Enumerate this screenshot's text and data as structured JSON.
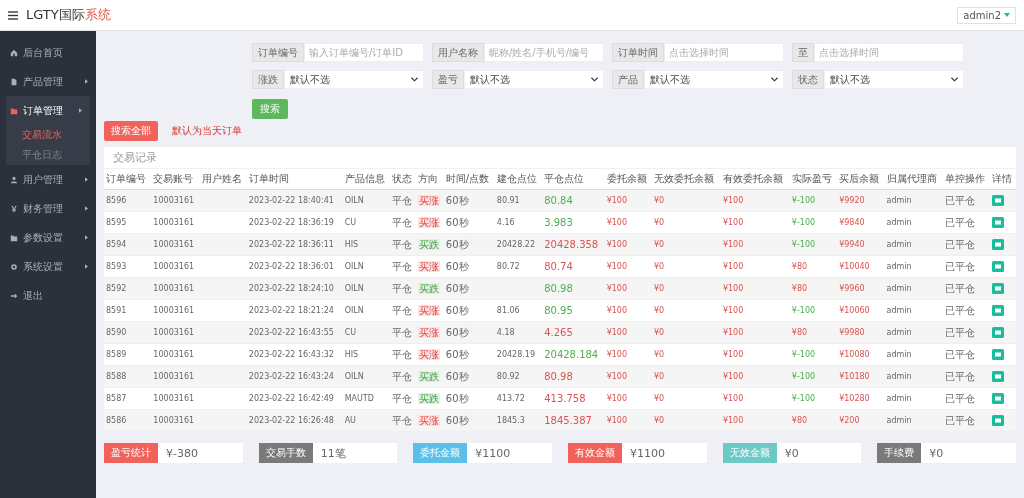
{
  "header": {
    "brand": "LGTY国际",
    "brand_accent": "系统",
    "user": "admin2"
  },
  "sidebar": {
    "items": [
      {
        "label": "后台首页",
        "has_arrow": false,
        "expanded": false,
        "selected": false
      },
      {
        "label": "产品管理",
        "has_arrow": true,
        "expanded": false,
        "selected": false
      },
      {
        "label": "订单管理",
        "has_arrow": true,
        "expanded": true,
        "selected": true,
        "children": [
          {
            "label": "交易流水",
            "selected": true
          },
          {
            "label": "平仓日志",
            "selected": false
          }
        ]
      },
      {
        "label": "用户管理",
        "has_arrow": true,
        "expanded": false,
        "selected": false
      },
      {
        "label": "财务管理",
        "has_arrow": true,
        "expanded": false,
        "selected": false
      },
      {
        "label": "参数设置",
        "has_arrow": true,
        "expanded": false,
        "selected": false
      },
      {
        "label": "系统设置",
        "has_arrow": true,
        "expanded": false,
        "selected": false
      },
      {
        "label": "退出",
        "has_arrow": false,
        "expanded": false,
        "selected": false
      }
    ]
  },
  "filters": [
    {
      "kind": "input",
      "label": "订单编号",
      "placeholder": "输入订单编号/订单ID"
    },
    {
      "kind": "input",
      "label": "用户名称",
      "placeholder": "昵称/姓名/手机号/编号"
    },
    {
      "kind": "input",
      "label": "订单时间",
      "placeholder": "点击选择时间"
    },
    {
      "kind": "input",
      "label": "至",
      "placeholder": "点击选择时间"
    },
    {
      "kind": "select",
      "label": "涨跌",
      "value": "默认不选"
    },
    {
      "kind": "select",
      "label": "盈亏",
      "value": "默认不选"
    },
    {
      "kind": "select",
      "label": "产品",
      "value": "默认不选"
    },
    {
      "kind": "select",
      "label": "状态",
      "value": "默认不选"
    }
  ],
  "search_button": "搜索",
  "search_all_button": "搜索全部",
  "default_note": "默认为当天订单",
  "table": {
    "title": "交易记录",
    "columns": [
      "订单编号",
      "交易账号",
      "用户姓名",
      "订单时间",
      "产品信息",
      "状态",
      "方向",
      "时间/点数",
      "建仓点位",
      "平仓点位",
      "委托余额",
      "无效委托余额",
      "有效委托余额",
      "实际盈亏",
      "买后余额",
      "归属代理商",
      "单控操作",
      "详情"
    ],
    "rows": [
      {
        "id": "8596",
        "account": "10003161",
        "time": "2023-02-22 18:40:41",
        "product": "OILN",
        "status": "平仓",
        "direction": "买涨",
        "rising": true,
        "period": "60秒",
        "open": "80.91",
        "close": "80.84",
        "close_fell": true,
        "amount": "¥100",
        "invalid": "¥0",
        "valid": "¥100",
        "pnl": "¥-100",
        "profit": false,
        "balance": "¥9920",
        "agent": "admin",
        "op": "已平仓"
      },
      {
        "id": "8595",
        "account": "10003161",
        "time": "2023-02-22 18:36:19",
        "product": "CU",
        "status": "平仓",
        "direction": "买涨",
        "rising": true,
        "period": "60秒",
        "open": "4.16",
        "close": "3.983",
        "close_fell": true,
        "amount": "¥100",
        "invalid": "¥0",
        "valid": "¥100",
        "pnl": "¥-100",
        "profit": false,
        "balance": "¥9840",
        "agent": "admin",
        "op": "已平仓"
      },
      {
        "id": "8594",
        "account": "10003161",
        "time": "2023-02-22 18:36:11",
        "product": "HIS",
        "status": "平仓",
        "direction": "买跌",
        "rising": false,
        "period": "60秒",
        "open": "20428.22",
        "close": "20428.358",
        "close_fell": false,
        "amount": "¥100",
        "invalid": "¥0",
        "valid": "¥100",
        "pnl": "¥-100",
        "profit": false,
        "balance": "¥9940",
        "agent": "admin",
        "op": "已平仓"
      },
      {
        "id": "8593",
        "account": "10003161",
        "time": "2023-02-22 18:36:01",
        "product": "OILN",
        "status": "平仓",
        "direction": "买涨",
        "rising": true,
        "period": "60秒",
        "open": "80.72",
        "close": "80.74",
        "close_fell": false,
        "amount": "¥100",
        "invalid": "¥0",
        "valid": "¥100",
        "pnl": "¥80",
        "profit": true,
        "balance": "¥10040",
        "agent": "admin",
        "op": "已平仓"
      },
      {
        "id": "8592",
        "account": "10003161",
        "time": "2023-02-22 18:24:10",
        "product": "OILN",
        "status": "平仓",
        "direction": "买跌",
        "rising": false,
        "period": "60秒",
        "close": "80.98",
        "close_fell": true,
        "amount": "¥100",
        "invalid": "¥0",
        "valid": "¥100",
        "pnl": "¥80",
        "profit": true,
        "balance": "¥9960",
        "agent": "admin",
        "op": "已平仓"
      },
      {
        "id": "8591",
        "account": "10003161",
        "time": "2023-02-22 18:21:24",
        "product": "OILN",
        "status": "平仓",
        "direction": "买涨",
        "rising": true,
        "period": "60秒",
        "open": "81.06",
        "close": "80.95",
        "close_fell": true,
        "amount": "¥100",
        "invalid": "¥0",
        "valid": "¥100",
        "pnl": "¥-100",
        "profit": false,
        "balance": "¥10060",
        "agent": "admin",
        "op": "已平仓"
      },
      {
        "id": "8590",
        "account": "10003161",
        "time": "2023-02-22 16:43:55",
        "product": "CU",
        "status": "平仓",
        "direction": "买涨",
        "rising": true,
        "period": "60秒",
        "open": "4.18",
        "close": "4.265",
        "close_fell": false,
        "amount": "¥100",
        "invalid": "¥0",
        "valid": "¥100",
        "pnl": "¥80",
        "profit": true,
        "balance": "¥9980",
        "agent": "admin",
        "op": "已平仓"
      },
      {
        "id": "8589",
        "account": "10003161",
        "time": "2023-02-22 16:43:32",
        "product": "HIS",
        "status": "平仓",
        "direction": "买涨",
        "rising": true,
        "period": "60秒",
        "open": "20428.19",
        "close": "20428.184",
        "close_fell": true,
        "amount": "¥100",
        "invalid": "¥0",
        "valid": "¥100",
        "pnl": "¥-100",
        "profit": false,
        "balance": "¥10080",
        "agent": "admin",
        "op": "已平仓"
      },
      {
        "id": "8588",
        "account": "10003161",
        "time": "2023-02-22 16:43:24",
        "product": "OILN",
        "status": "平仓",
        "direction": "买跌",
        "rising": false,
        "period": "60秒",
        "open": "80.92",
        "close": "80.98",
        "close_fell": false,
        "amount": "¥100",
        "invalid": "¥0",
        "valid": "¥100",
        "pnl": "¥-100",
        "profit": false,
        "balance": "¥10180",
        "agent": "admin",
        "op": "已平仓"
      },
      {
        "id": "8587",
        "account": "10003161",
        "time": "2023-02-22 16:42:49",
        "product": "MAUTD",
        "status": "平仓",
        "direction": "买跌",
        "rising": false,
        "period": "60秒",
        "open": "413.72",
        "close": "413.758",
        "close_fell": false,
        "amount": "¥100",
        "invalid": "¥0",
        "valid": "¥100",
        "pnl": "¥-100",
        "profit": false,
        "balance": "¥10280",
        "agent": "admin",
        "op": "已平仓"
      },
      {
        "id": "8586",
        "account": "10003161",
        "time": "2023-02-22 16:26:48",
        "product": "AU",
        "status": "平仓",
        "direction": "买涨",
        "rising": true,
        "period": "60秒",
        "open": "1845.3",
        "close": "1845.387",
        "close_fell": false,
        "amount": "¥100",
        "invalid": "¥0",
        "valid": "¥100",
        "pnl": "¥80",
        "profit": true,
        "balance": "¥200",
        "agent": "admin",
        "op": "已平仓"
      }
    ]
  },
  "stats": [
    {
      "label": "盈亏统计",
      "value": "¥-380",
      "color": "#f0625a"
    },
    {
      "label": "交易手数",
      "value": "11笔",
      "color": "#7a7a7a"
    },
    {
      "label": "委托金额",
      "value": "¥1100",
      "color": "#5bc0e8"
    },
    {
      "label": "有效金额",
      "value": "¥1100",
      "color": "#f0625a"
    },
    {
      "label": "无效金额",
      "value": "¥0",
      "color": "#6cc9c6"
    },
    {
      "label": "手续费",
      "value": "¥0",
      "color": "#7a7a7a"
    }
  ]
}
